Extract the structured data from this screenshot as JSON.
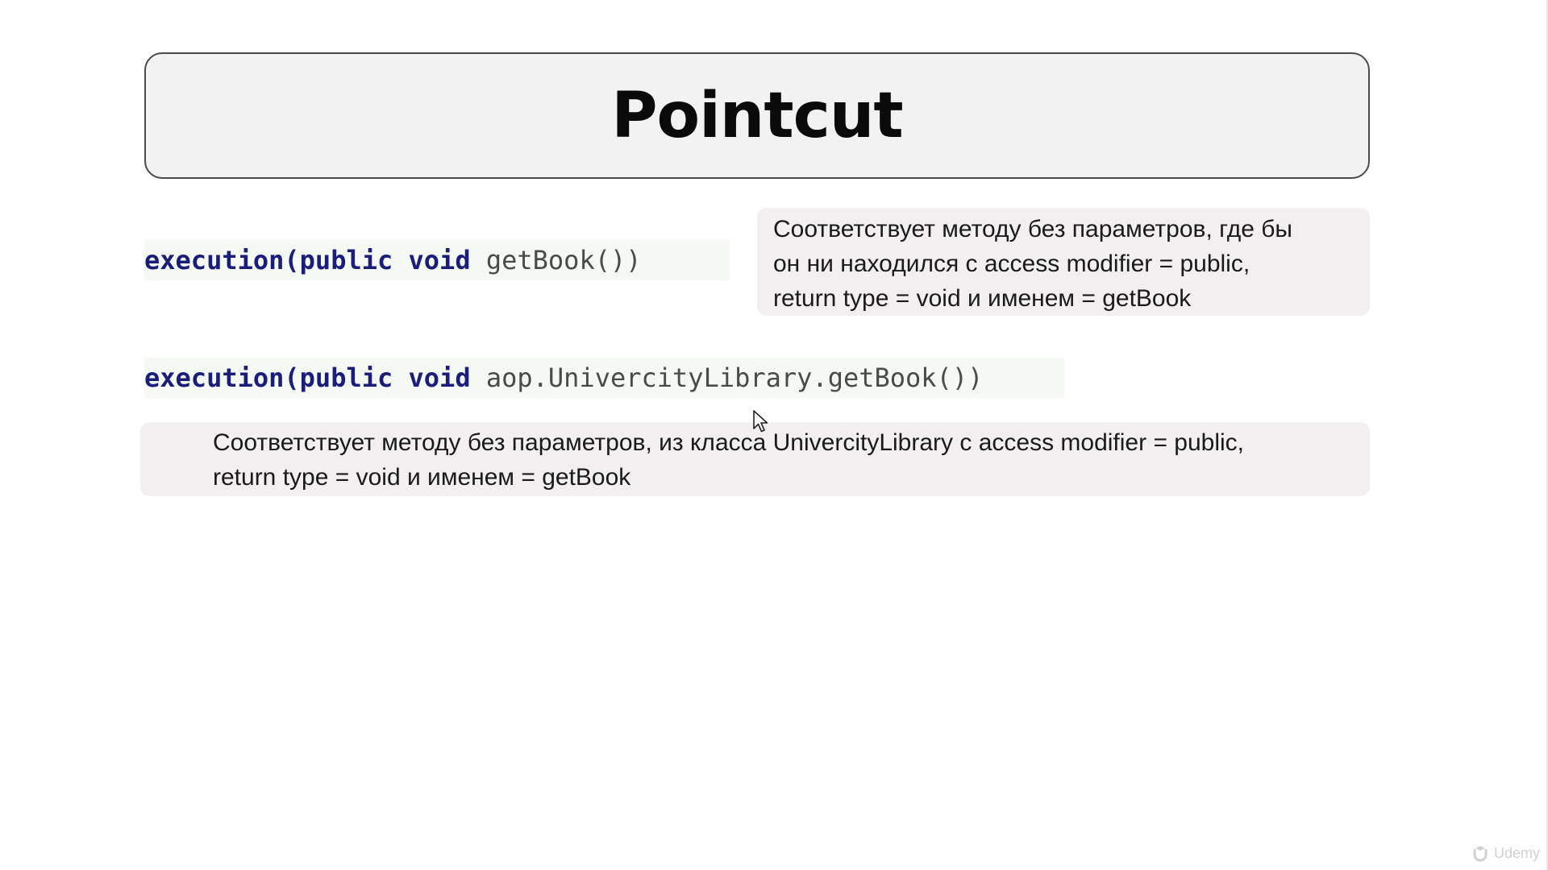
{
  "slide": {
    "title": "Pointcut",
    "example_1": {
      "code_keyword": "execution(public void",
      "code_rest": " getBook())",
      "description_lines": [
        "Соответствует методу без параметров, где бы",
        "он ни находился с access modifier = public,",
        "return type = void и именем = getBook"
      ]
    },
    "example_2": {
      "code_keyword": "execution(public void",
      "code_rest": " aop.UnivercityLibrary.getBook())",
      "description_lines": [
        "Соответствует методу без параметров, из класса UnivercityLibrary с access modifier = public,",
        "return type = void и именем = getBook"
      ]
    },
    "watermark": "Udemy"
  }
}
